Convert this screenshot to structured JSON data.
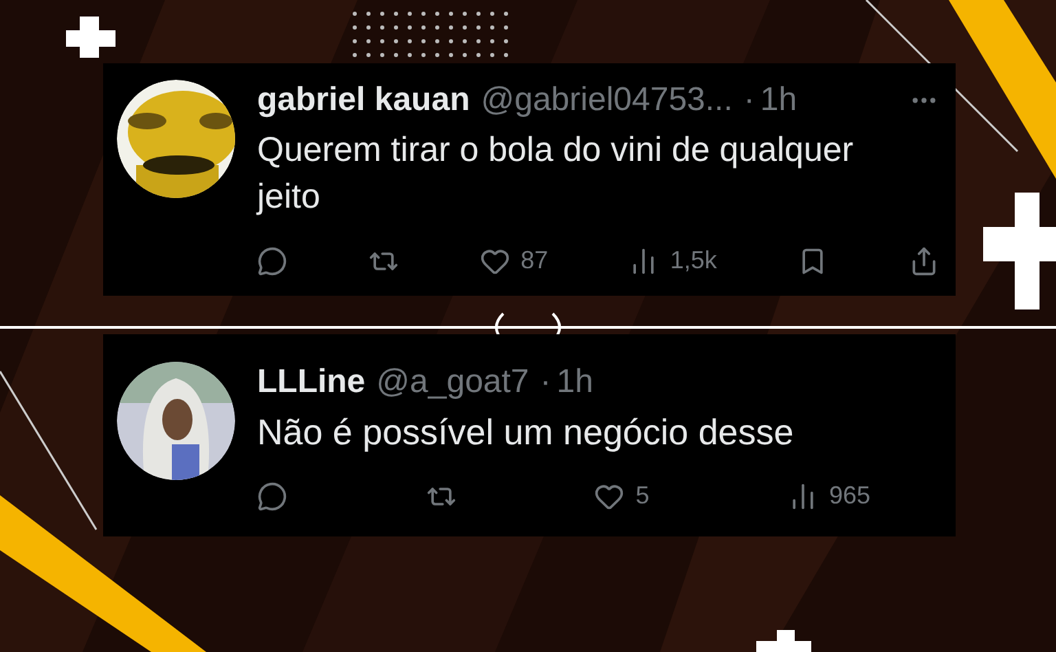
{
  "tweets": [
    {
      "name": "gabriel kauan",
      "handle": "@gabriel04753...",
      "separator": "·",
      "time": "1h",
      "text": "Querem tirar o bola do vini de qualquer jeito",
      "more": true,
      "actions": [
        {
          "kind": "reply"
        },
        {
          "kind": "retweet"
        },
        {
          "kind": "like",
          "count": "87"
        },
        {
          "kind": "views",
          "count": "1,5k"
        },
        {
          "kind": "bookmark"
        },
        {
          "kind": "share"
        }
      ]
    },
    {
      "name": "LLLine",
      "handle": "@a_goat7",
      "separator": "·",
      "time": "1h",
      "text": "Não é possível um negócio desse",
      "more": false,
      "actions": [
        {
          "kind": "reply"
        },
        {
          "kind": "retweet"
        },
        {
          "kind": "like",
          "count": "5"
        },
        {
          "kind": "views",
          "count": "965"
        }
      ]
    }
  ]
}
